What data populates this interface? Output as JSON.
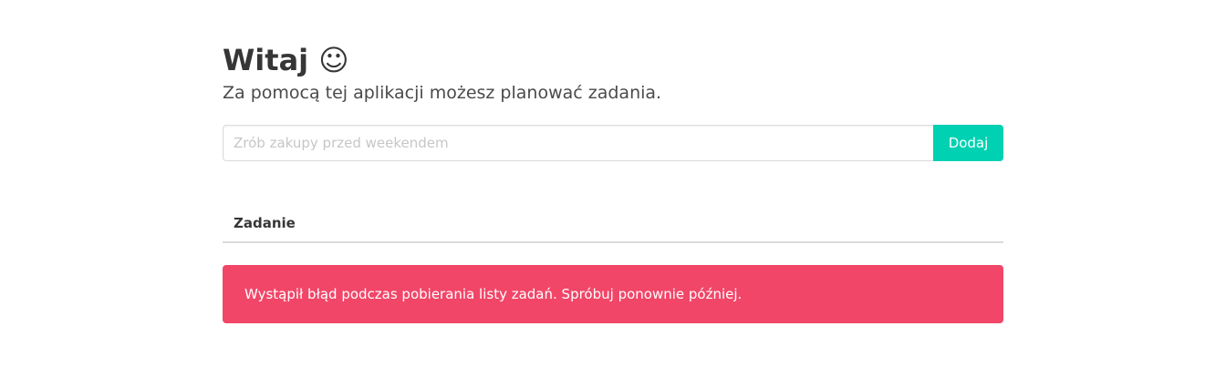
{
  "header": {
    "title": "Witaj ☺",
    "subtitle": "Za pomocą tej aplikacji możesz planować zadania."
  },
  "form": {
    "input_value": "",
    "input_placeholder": "Zrób zakupy przed weekendem",
    "add_label": "Dodaj"
  },
  "table": {
    "columns": [
      "Zadanie"
    ],
    "rows": []
  },
  "error": {
    "message": "Wystąpił błąd podczas pobierania listy zadań. Spróbuj ponownie później."
  },
  "colors": {
    "primary": "#00d1b2",
    "danger": "#f14668",
    "text": "#363636"
  }
}
